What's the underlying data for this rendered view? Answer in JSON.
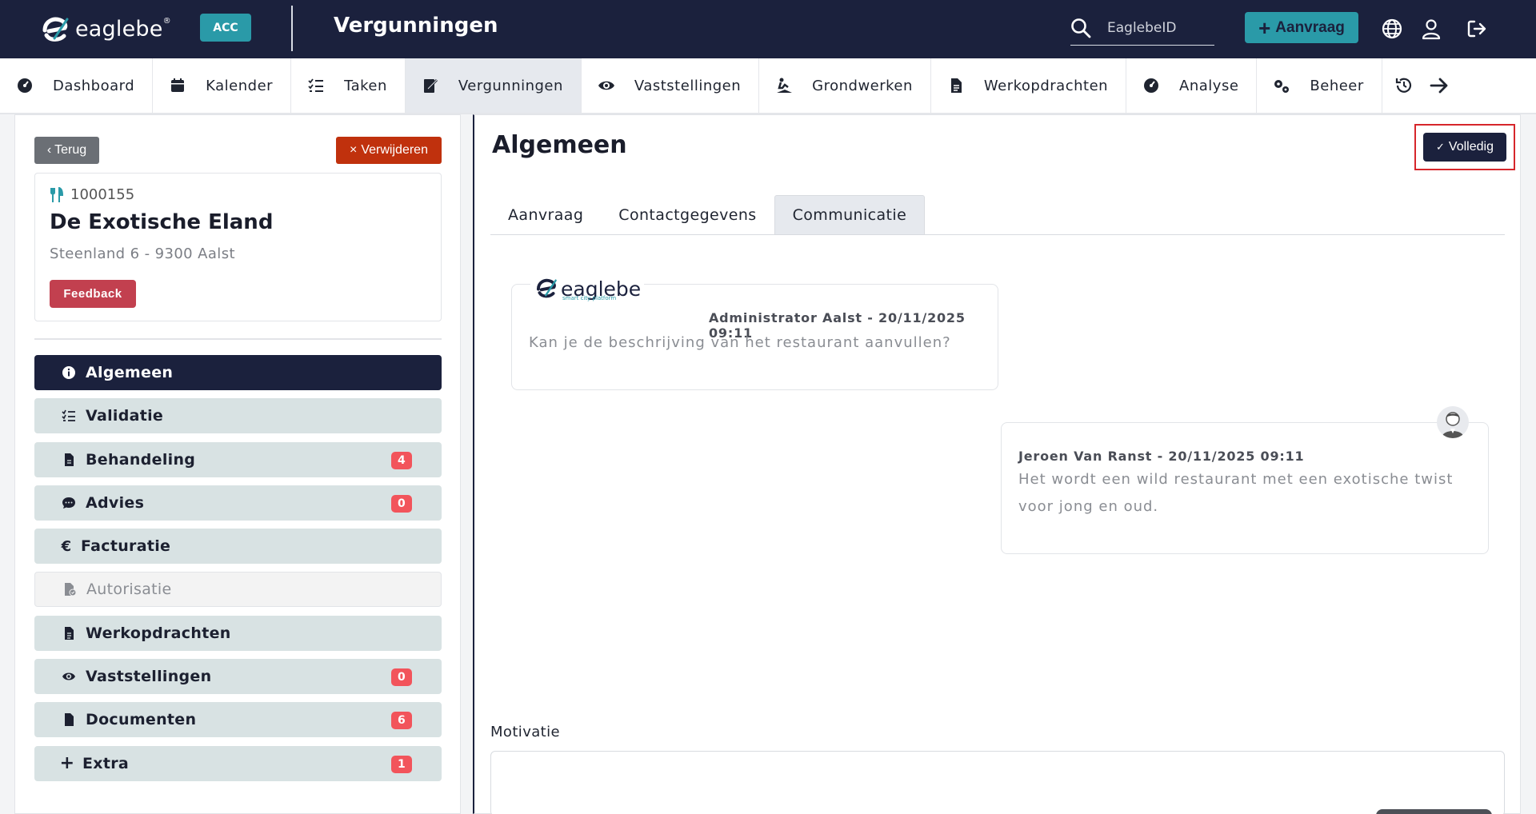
{
  "topbar": {
    "logo_text": "eaglebe",
    "logo_reg": "®",
    "env_badge": "ACC",
    "module_title": "Vergunningen",
    "search_placeholder": "EaglebeID",
    "new_request_label": "Aanvraag",
    "icons": [
      "search-icon",
      "globe-icon",
      "user-icon",
      "logout-icon"
    ]
  },
  "nav": {
    "items": [
      {
        "label": "Dashboard",
        "icon": "gauge-icon"
      },
      {
        "label": "Kalender",
        "icon": "calendar-icon"
      },
      {
        "label": "Taken",
        "icon": "tasks-icon"
      },
      {
        "label": "Vergunningen",
        "icon": "permit-icon",
        "active": true
      },
      {
        "label": "Vaststellingen",
        "icon": "eye-icon"
      },
      {
        "label": "Grondwerken",
        "icon": "digging-icon"
      },
      {
        "label": "Werkopdrachten",
        "icon": "document-icon"
      },
      {
        "label": "Analyse",
        "icon": "gauge-icon"
      },
      {
        "label": "Beheer",
        "icon": "cogs-icon"
      }
    ]
  },
  "left": {
    "back_label": "Terug",
    "delete_label": "Verwijderen",
    "dossier_id": "1000155",
    "dossier_name": "De Exotische Eland",
    "dossier_address": "Steenland 6 - 9300 Aalst",
    "feedback_label": "Feedback",
    "menu": [
      {
        "label": "Algemeen",
        "icon": "info-icon",
        "active": true
      },
      {
        "label": "Validatie",
        "icon": "checklist-icon"
      },
      {
        "label": "Behandeling",
        "icon": "file-icon",
        "badge": "4"
      },
      {
        "label": "Advies",
        "icon": "comment-icon",
        "badge": "0"
      },
      {
        "label": "Facturatie",
        "icon": "euro-icon"
      },
      {
        "label": "Autorisatie",
        "icon": "file-lock-icon",
        "disabled": true
      },
      {
        "label": "Werkopdrachten",
        "icon": "document-icon"
      },
      {
        "label": "Vaststellingen",
        "icon": "eye-icon",
        "badge": "0"
      },
      {
        "label": "Documenten",
        "icon": "file-icon",
        "badge": "6"
      },
      {
        "label": "Extra",
        "icon": "plus-icon",
        "badge": "1"
      }
    ]
  },
  "main": {
    "title": "Algemeen",
    "complete_label": "Volledig",
    "tabs": [
      {
        "label": "Aanvraag"
      },
      {
        "label": "Contactgegevens"
      },
      {
        "label": "Communicatie",
        "active": true
      }
    ],
    "messages": [
      {
        "logo_text": "eaglebe",
        "logo_tagline": "smart city platform",
        "author": "Administrator Aalst - 20/11/2025 09:11",
        "body_line1": "Kan je de beschrijving van het restaurant aanvullen?",
        "body_line2": ""
      },
      {
        "author": "Jeroen Van Ranst - 20/11/2025 09:11",
        "body_line1": "Het wordt een wild restaurant met een exotische twist",
        "body_line2": "voor jong en oud."
      }
    ],
    "motivatie_label": "Motivatie",
    "motivatie_value": ""
  },
  "colors": {
    "navy": "#1b213d",
    "teal": "#2a9aa8",
    "danger": "#c0310d",
    "badge": "#f2545b",
    "menu_bg": "#d8e2e3"
  }
}
